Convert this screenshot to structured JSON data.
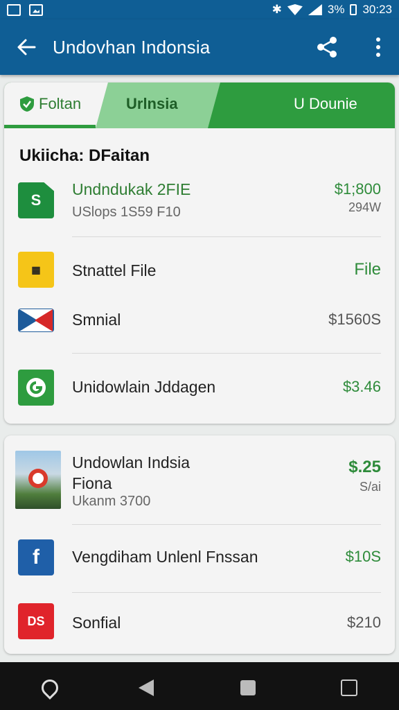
{
  "status_bar": {
    "battery": "3%",
    "time": "30:23"
  },
  "app_bar": {
    "title": "Undovhan Indonsia"
  },
  "tabs": [
    {
      "label": "Foltan"
    },
    {
      "label": "Urlnsia"
    },
    {
      "label": "U Dounie"
    }
  ],
  "card1": {
    "section_title": "Ukiicha: DFaitan",
    "rows": [
      {
        "icon": "sheets-icon",
        "icon_text": "S",
        "name": "Undndukak 2FIE",
        "sub": "USlops 1S59 F10",
        "price": "$1;800",
        "price2": "294W"
      },
      {
        "icon": "folder-icon",
        "name": "Stnattel File",
        "price": "File"
      },
      {
        "icon": "flag-icon",
        "name": "Smnial",
        "price": "$1560S"
      },
      {
        "icon": "green-app-icon",
        "name": "Unidowlain Jddagen",
        "price": "$3.46"
      }
    ]
  },
  "card2": {
    "rows": [
      {
        "icon": "photo-thumbnail",
        "name": "Undowlan Indsia",
        "name2": "Fiona",
        "sub": "Ukanm 3700",
        "price": "$.25",
        "price2": "S/ai"
      },
      {
        "icon": "facebook-icon",
        "icon_text": "f",
        "name": "Vengdiham Unlenl Fnssan",
        "price": "$10S"
      },
      {
        "icon": "ds-icon",
        "icon_text": "DS",
        "name": "Sonfial",
        "price": "$210"
      }
    ]
  },
  "colors": {
    "primary": "#0f5e95",
    "accent_green": "#2e9c3f",
    "light_green": "#8cd096",
    "card_bg": "#f4f4f4"
  }
}
